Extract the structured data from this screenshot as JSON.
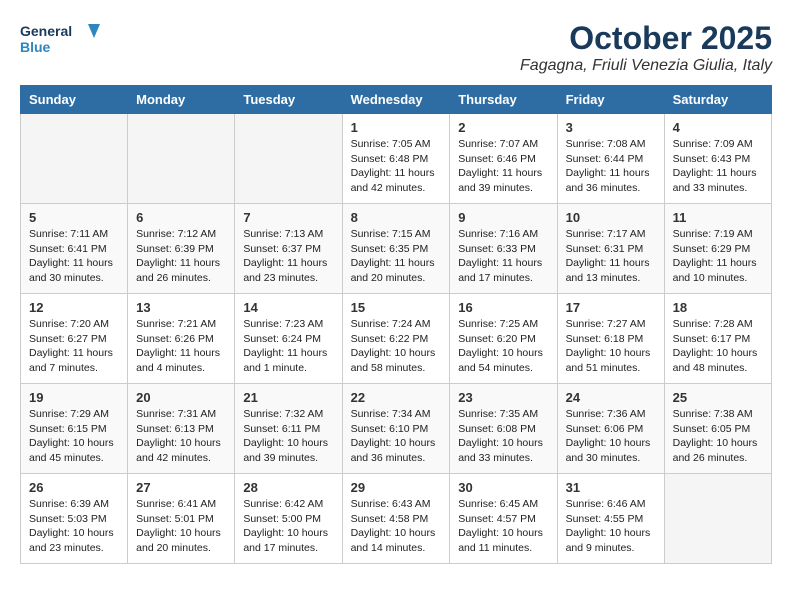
{
  "logo": {
    "line1": "General",
    "line2": "Blue"
  },
  "title": "October 2025",
  "subtitle": "Fagagna, Friuli Venezia Giulia, Italy",
  "days_of_week": [
    "Sunday",
    "Monday",
    "Tuesday",
    "Wednesday",
    "Thursday",
    "Friday",
    "Saturday"
  ],
  "weeks": [
    [
      {
        "day": "",
        "info": ""
      },
      {
        "day": "",
        "info": ""
      },
      {
        "day": "",
        "info": ""
      },
      {
        "day": "1",
        "info": "Sunrise: 7:05 AM\nSunset: 6:48 PM\nDaylight: 11 hours and 42 minutes."
      },
      {
        "day": "2",
        "info": "Sunrise: 7:07 AM\nSunset: 6:46 PM\nDaylight: 11 hours and 39 minutes."
      },
      {
        "day": "3",
        "info": "Sunrise: 7:08 AM\nSunset: 6:44 PM\nDaylight: 11 hours and 36 minutes."
      },
      {
        "day": "4",
        "info": "Sunrise: 7:09 AM\nSunset: 6:43 PM\nDaylight: 11 hours and 33 minutes."
      }
    ],
    [
      {
        "day": "5",
        "info": "Sunrise: 7:11 AM\nSunset: 6:41 PM\nDaylight: 11 hours and 30 minutes."
      },
      {
        "day": "6",
        "info": "Sunrise: 7:12 AM\nSunset: 6:39 PM\nDaylight: 11 hours and 26 minutes."
      },
      {
        "day": "7",
        "info": "Sunrise: 7:13 AM\nSunset: 6:37 PM\nDaylight: 11 hours and 23 minutes."
      },
      {
        "day": "8",
        "info": "Sunrise: 7:15 AM\nSunset: 6:35 PM\nDaylight: 11 hours and 20 minutes."
      },
      {
        "day": "9",
        "info": "Sunrise: 7:16 AM\nSunset: 6:33 PM\nDaylight: 11 hours and 17 minutes."
      },
      {
        "day": "10",
        "info": "Sunrise: 7:17 AM\nSunset: 6:31 PM\nDaylight: 11 hours and 13 minutes."
      },
      {
        "day": "11",
        "info": "Sunrise: 7:19 AM\nSunset: 6:29 PM\nDaylight: 11 hours and 10 minutes."
      }
    ],
    [
      {
        "day": "12",
        "info": "Sunrise: 7:20 AM\nSunset: 6:27 PM\nDaylight: 11 hours and 7 minutes."
      },
      {
        "day": "13",
        "info": "Sunrise: 7:21 AM\nSunset: 6:26 PM\nDaylight: 11 hours and 4 minutes."
      },
      {
        "day": "14",
        "info": "Sunrise: 7:23 AM\nSunset: 6:24 PM\nDaylight: 11 hours and 1 minute."
      },
      {
        "day": "15",
        "info": "Sunrise: 7:24 AM\nSunset: 6:22 PM\nDaylight: 10 hours and 58 minutes."
      },
      {
        "day": "16",
        "info": "Sunrise: 7:25 AM\nSunset: 6:20 PM\nDaylight: 10 hours and 54 minutes."
      },
      {
        "day": "17",
        "info": "Sunrise: 7:27 AM\nSunset: 6:18 PM\nDaylight: 10 hours and 51 minutes."
      },
      {
        "day": "18",
        "info": "Sunrise: 7:28 AM\nSunset: 6:17 PM\nDaylight: 10 hours and 48 minutes."
      }
    ],
    [
      {
        "day": "19",
        "info": "Sunrise: 7:29 AM\nSunset: 6:15 PM\nDaylight: 10 hours and 45 minutes."
      },
      {
        "day": "20",
        "info": "Sunrise: 7:31 AM\nSunset: 6:13 PM\nDaylight: 10 hours and 42 minutes."
      },
      {
        "day": "21",
        "info": "Sunrise: 7:32 AM\nSunset: 6:11 PM\nDaylight: 10 hours and 39 minutes."
      },
      {
        "day": "22",
        "info": "Sunrise: 7:34 AM\nSunset: 6:10 PM\nDaylight: 10 hours and 36 minutes."
      },
      {
        "day": "23",
        "info": "Sunrise: 7:35 AM\nSunset: 6:08 PM\nDaylight: 10 hours and 33 minutes."
      },
      {
        "day": "24",
        "info": "Sunrise: 7:36 AM\nSunset: 6:06 PM\nDaylight: 10 hours and 30 minutes."
      },
      {
        "day": "25",
        "info": "Sunrise: 7:38 AM\nSunset: 6:05 PM\nDaylight: 10 hours and 26 minutes."
      }
    ],
    [
      {
        "day": "26",
        "info": "Sunrise: 6:39 AM\nSunset: 5:03 PM\nDaylight: 10 hours and 23 minutes."
      },
      {
        "day": "27",
        "info": "Sunrise: 6:41 AM\nSunset: 5:01 PM\nDaylight: 10 hours and 20 minutes."
      },
      {
        "day": "28",
        "info": "Sunrise: 6:42 AM\nSunset: 5:00 PM\nDaylight: 10 hours and 17 minutes."
      },
      {
        "day": "29",
        "info": "Sunrise: 6:43 AM\nSunset: 4:58 PM\nDaylight: 10 hours and 14 minutes."
      },
      {
        "day": "30",
        "info": "Sunrise: 6:45 AM\nSunset: 4:57 PM\nDaylight: 10 hours and 11 minutes."
      },
      {
        "day": "31",
        "info": "Sunrise: 6:46 AM\nSunset: 4:55 PM\nDaylight: 10 hours and 9 minutes."
      },
      {
        "day": "",
        "info": ""
      }
    ]
  ]
}
